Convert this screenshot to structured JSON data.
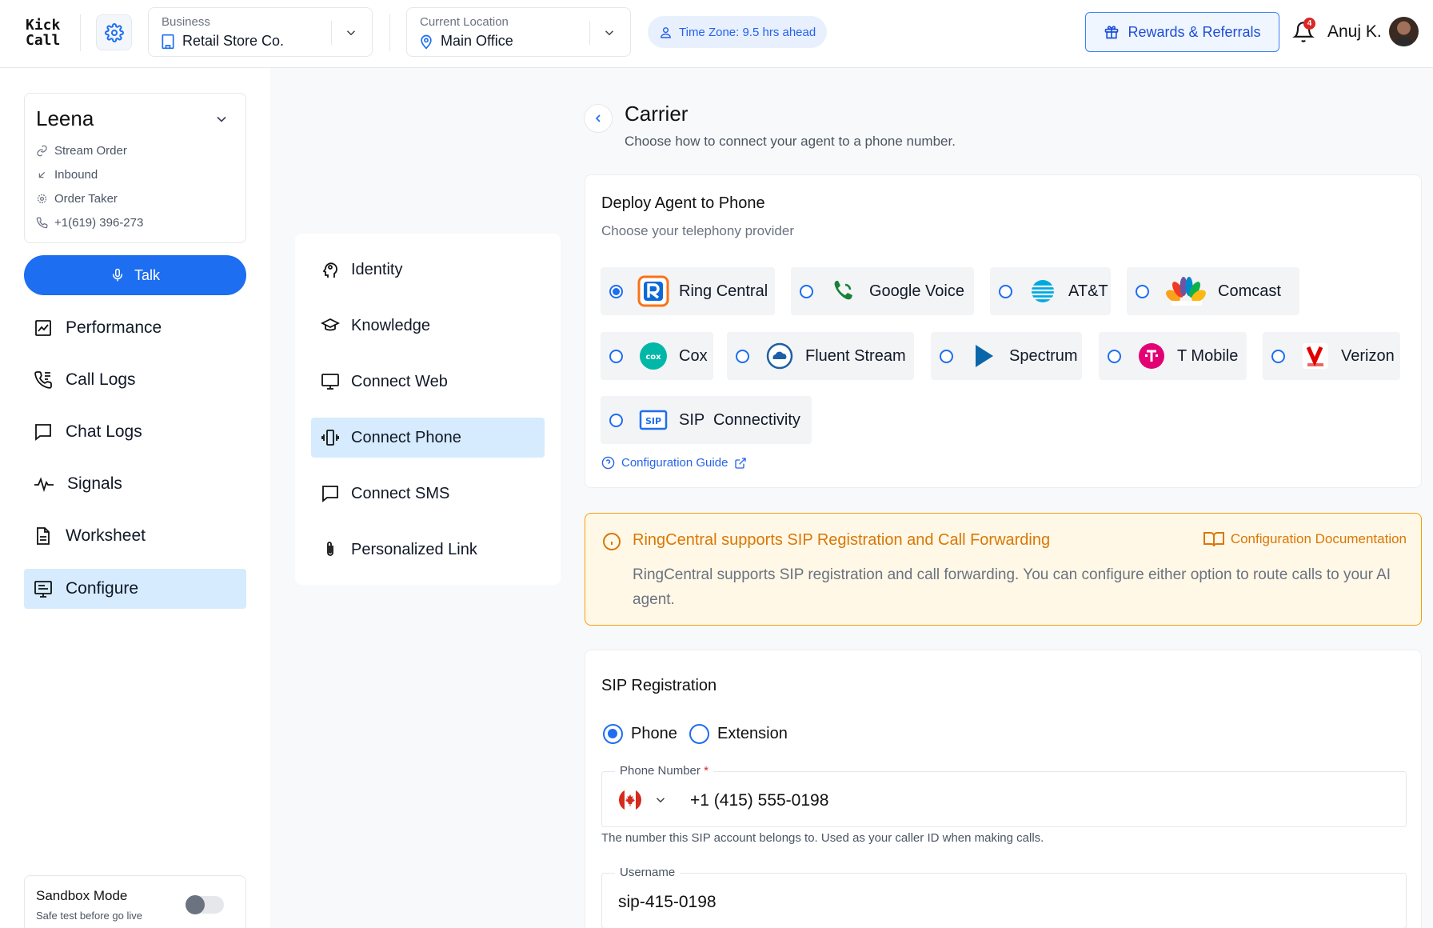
{
  "app": {
    "logo_line1": "Kick",
    "logo_line2": "Call"
  },
  "header": {
    "business_label": "Business",
    "business_value": "Retail Store Co.",
    "location_label": "Current Location",
    "location_value": "Main Office",
    "timezone": "Time Zone: 9.5 hrs ahead",
    "rewards_label": "Rewards & Referrals",
    "notification_count": "4",
    "user_name": "Anuj K."
  },
  "agent": {
    "name": "Leena",
    "meta": [
      "Stream Order",
      "Inbound",
      "Order Taker",
      "+1(619) 396-273"
    ],
    "talk_label": "Talk"
  },
  "nav": {
    "items": [
      {
        "label": "Performance",
        "icon": "chart-icon"
      },
      {
        "label": "Call Logs",
        "icon": "phone-log-icon"
      },
      {
        "label": "Chat Logs",
        "icon": "chat-icon"
      },
      {
        "label": "Signals",
        "icon": "pulse-icon"
      },
      {
        "label": "Worksheet",
        "icon": "document-icon"
      },
      {
        "label": "Configure",
        "icon": "configure-icon",
        "active": true
      }
    ]
  },
  "sandbox": {
    "title": "Sandbox Mode",
    "subtitle": "Safe test before go live",
    "enabled": false
  },
  "config_nav": {
    "items": [
      {
        "label": "Identity"
      },
      {
        "label": "Knowledge"
      },
      {
        "label": "Connect Web"
      },
      {
        "label": "Connect Phone",
        "active": true
      },
      {
        "label": "Connect SMS"
      },
      {
        "label": "Personalized Link"
      }
    ]
  },
  "page": {
    "title": "Carrier",
    "subtitle": "Choose how to connect your agent to a phone number."
  },
  "deploy": {
    "title": "Deploy Agent to Phone",
    "subtitle": "Choose your telephony provider",
    "providers": [
      {
        "label": "Ring Central",
        "selected": true
      },
      {
        "label": "Google Voice"
      },
      {
        "label": "AT&T"
      },
      {
        "label": "Comcast"
      },
      {
        "label": "Cox",
        "logo_text": "cox"
      },
      {
        "label": "Fluent Stream"
      },
      {
        "label": "Spectrum"
      },
      {
        "label": "T Mobile"
      },
      {
        "label": "Verizon"
      },
      {
        "label": "SIP  Connectivity",
        "logo_text": "SIP"
      }
    ],
    "guide_link": "Configuration Guide"
  },
  "notice": {
    "title": "RingCentral supports SIP Registration and Call Forwarding",
    "doc_link": "Configuration Documentation",
    "body": "RingCentral supports SIP registration and call forwarding. You can configure either option to route calls to your AI agent."
  },
  "sip": {
    "title": "SIP Registration",
    "options": [
      "Phone",
      "Extension"
    ],
    "selected_option": "Phone",
    "phone_label": "Phone Number",
    "required_mark": "*",
    "phone_value": "+1 (415) 555-0198",
    "phone_helper": "The number this SIP account belongs to. Used as your caller ID when making calls.",
    "username_label": "Username",
    "username_value": "sip-415-0198"
  },
  "colors": {
    "primary": "#1d6ef0",
    "active_bg": "#d6ebfd",
    "warning": "#d97706",
    "warning_bg": "#fff8e6"
  }
}
